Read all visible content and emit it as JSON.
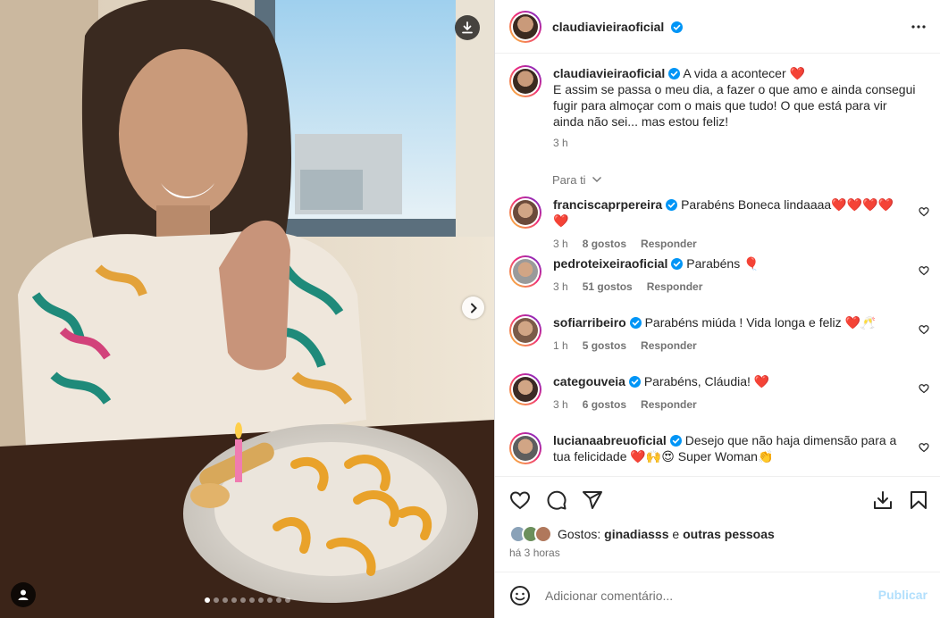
{
  "post": {
    "author": "claudiavieiraoficial",
    "caption_title": "A vida a acontecer",
    "caption_body": "E assim se passa o meu dia, a fazer o que amo e ainda consegui fugir para almoçar com o mais que tudo! O que está para vir ainda não sei... mas estou feliz!",
    "caption_time": "3 h",
    "sort_label": "Para ti",
    "heart_emoji": "❤️"
  },
  "comments": [
    {
      "user": "franciscaprpereira",
      "text": "Parabéns Boneca lindaaaa❤️❤️❤️❤️❤️",
      "time": "3 h",
      "likes": "8 gostos",
      "reply": "Responder",
      "avatar_color": "#6b4a3a"
    },
    {
      "user": "pedroteixeiraoficial",
      "text": "Parabéns 🎈",
      "time": "3 h",
      "likes": "51 gostos",
      "reply": "Responder",
      "avatar_color": "#9a9a9a"
    },
    {
      "user": "sofiarribeiro",
      "text": "Parabéns miúda ! Vida longa e feliz ❤️🥂",
      "time": "1 h",
      "likes": "5 gostos",
      "reply": "Responder",
      "avatar_color": "#7b5b48"
    },
    {
      "user": "categouveia",
      "text": "Parabéns, Cláudia! ❤️",
      "time": "3 h",
      "likes": "6 gostos",
      "reply": "Responder",
      "avatar_color": "#3b2a24"
    },
    {
      "user": "lucianaabreuoficial",
      "text": "Desejo que não haja dimensão para a tua felicidade ❤️🙌😍 Super Woman👏",
      "time": "",
      "likes": "",
      "reply": "",
      "avatar_color": "#5e5e5e"
    }
  ],
  "likes_line": {
    "prefix": "Gostos:",
    "user": "ginadiasss",
    "connector": "e",
    "others": "outras pessoas"
  },
  "posted_ago": "há 3 horas",
  "add_comment": {
    "placeholder": "Adicionar comentário...",
    "publish_label": "Publicar"
  },
  "carousel": {
    "total": 10,
    "active": 1
  },
  "icons": {
    "download": "download-icon",
    "next": "chevron-right-icon",
    "user_tag": "user-tag-icon",
    "more": "more-options-icon",
    "like": "heart-icon",
    "comment": "comment-icon",
    "share": "share-icon",
    "save_download": "save-download-icon",
    "bookmark": "bookmark-icon",
    "emoji": "emoji-icon",
    "verified": "verified-badge-icon"
  },
  "colors": {
    "verified": "#0095f6",
    "publish_disabled": "#b2dffc",
    "secondary_text": "#737373",
    "story_ring_start": "#f9ce34",
    "story_ring_end": "#6228d7"
  }
}
